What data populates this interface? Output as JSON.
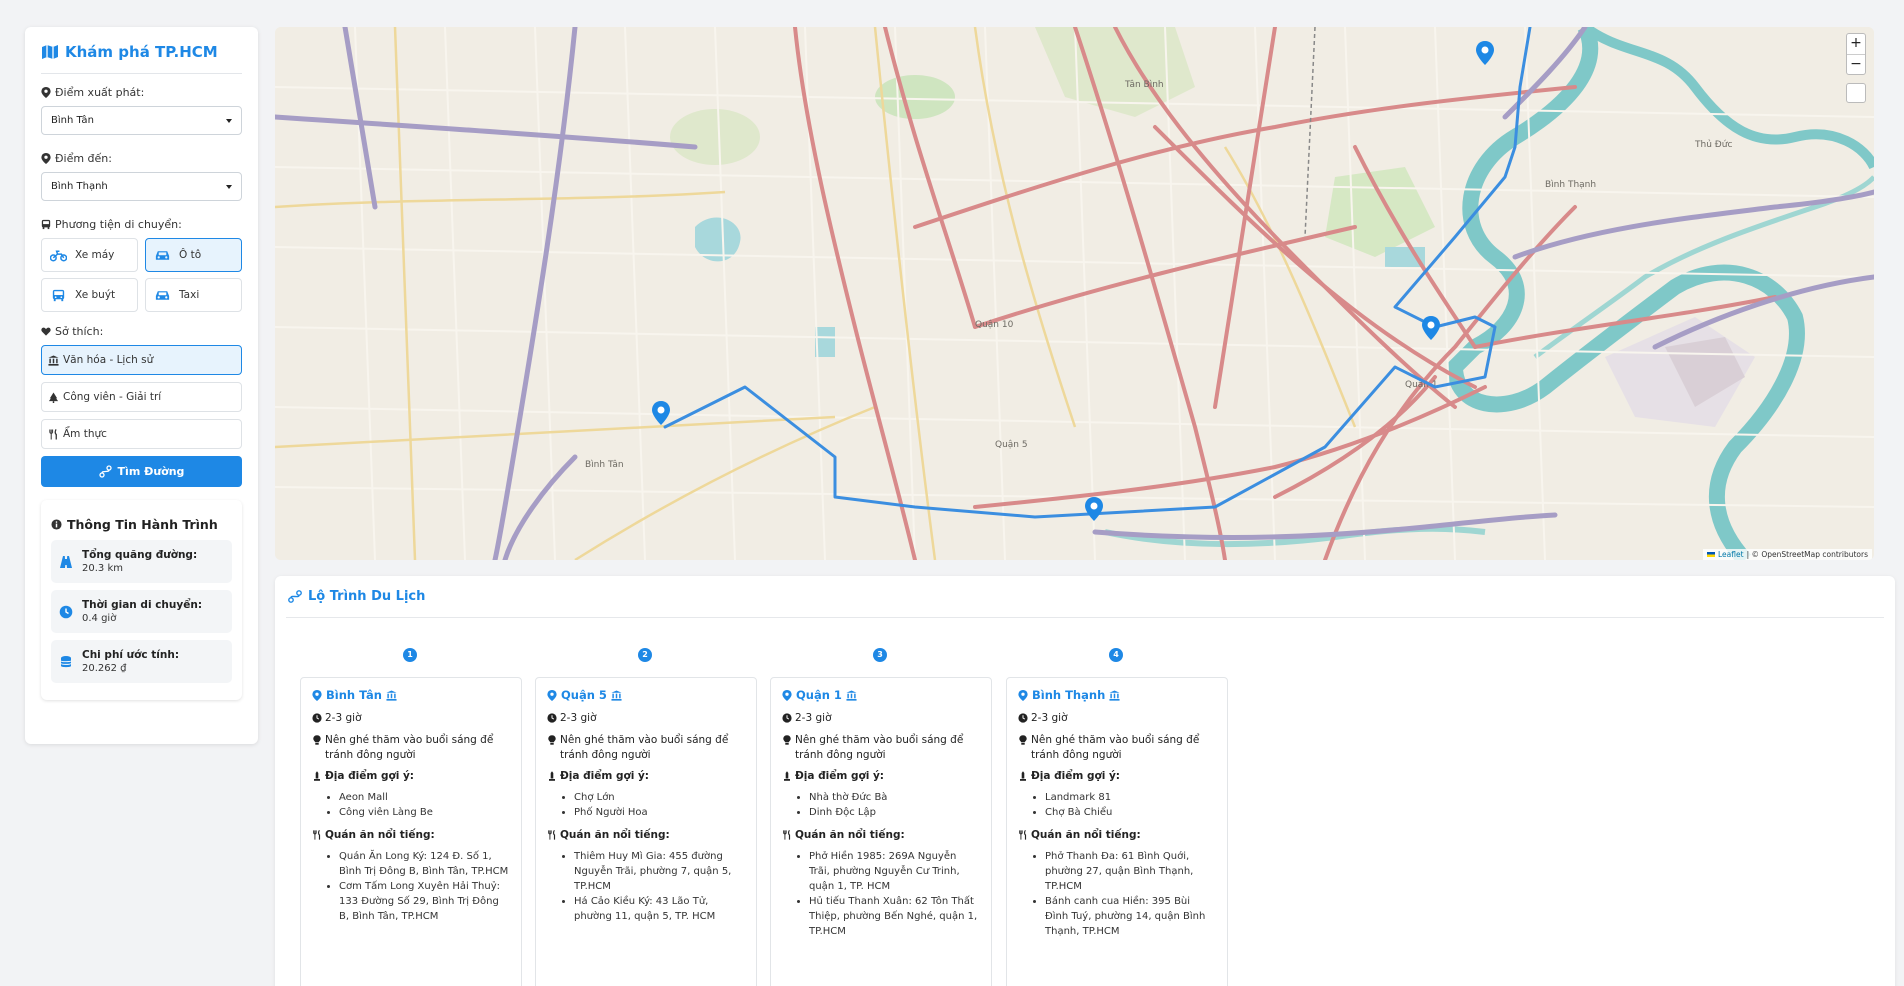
{
  "sidebar": {
    "brand": "Khám phá TP.HCM",
    "start_label": "Điểm xuất phát:",
    "start_value": "Bình Tân",
    "end_label": "Điểm đến:",
    "end_value": "Bình Thạnh",
    "transport_label": "Phương tiện di chuyển:",
    "transports": [
      {
        "label": "Xe máy",
        "active": false
      },
      {
        "label": "Ô tô",
        "active": true
      },
      {
        "label": "Xe buýt",
        "active": false
      },
      {
        "label": "Taxi",
        "active": false
      }
    ],
    "prefs_label": "Sở thích:",
    "prefs": [
      {
        "label": "Văn hóa - Lịch sử",
        "active": true
      },
      {
        "label": "Công viên - Giải trí",
        "active": false
      },
      {
        "label": "Ẩm thực",
        "active": false
      }
    ],
    "find_button": "Tìm Đường",
    "trip_info": {
      "title": "Thông Tin Hành Trình",
      "distance_label": "Tổng quãng đường:",
      "distance_value": "20.3 km",
      "time_label": "Thời gian di chuyển:",
      "time_value": "0.4 giờ",
      "cost_label": "Chi phí ước tính:",
      "cost_value": "20.262 ₫"
    }
  },
  "map": {
    "zoom_in": "+",
    "zoom_out": "−",
    "attribution_leaflet": "Leaflet",
    "attribution_rest": "| © OpenStreetMap contributors",
    "labels": {
      "binh_tan": "Bình Tân",
      "tan_binh": "Tân Bình",
      "quan_10": "Quận 10",
      "quan_1": "Quận 1",
      "binh_thanh": "Bình Thạnh",
      "quan_5": "Quận 5",
      "thu_duc": "Thủ Đức"
    },
    "colors": {
      "route": "#3b8ee0",
      "river": "#7fc8c8",
      "major_road": "#d88a8a",
      "marker": "#1e88e5"
    }
  },
  "itinerary": {
    "title": "Lộ Trình Du Lịch",
    "duration_label": "2-3 giờ",
    "tip_text": "Nên ghé thăm vào buổi sáng để tránh đông người",
    "places_label": "Địa điểm gợi ý:",
    "food_label": "Quán ăn nổi tiếng:",
    "stops": [
      {
        "num": "1",
        "name": "Bình Tân",
        "places": [
          "Aeon Mall",
          "Công viên Làng Be"
        ],
        "foods": [
          "Quán Ăn Long Ký: 124 Đ. Số 1, Bình Trị Đông B, Bình Tân, TP.HCM",
          "Cơm Tấm Long Xuyên Hải Thuỷ: 133 Đường Số 29, Bình Trị Đông B, Bình Tân, TP.HCM"
        ]
      },
      {
        "num": "2",
        "name": "Quận 5",
        "places": [
          "Chợ Lớn",
          "Phố Người Hoa"
        ],
        "foods": [
          "Thiêm Huy Mì Gia: 455 đường Nguyễn Trãi, phường 7, quận 5, TP.HCM",
          "Há Cảo Kiều Ký: 43 Lão Tử, phường 11, quận 5, TP. HCM"
        ]
      },
      {
        "num": "3",
        "name": "Quận 1",
        "places": [
          "Nhà thờ Đức Bà",
          "Dinh Độc Lập"
        ],
        "foods": [
          "Phở Hiền 1985: 269A Nguyễn Trãi, phường Nguyễn Cư Trinh, quận 1, TP. HCM",
          "Hủ tiếu Thanh Xuân: 62 Tôn Thất Thiệp, phường Bến Nghé, quận 1, TP.HCM"
        ]
      },
      {
        "num": "4",
        "name": "Bình Thạnh",
        "places": [
          "Landmark 81",
          "Chợ Bà Chiểu"
        ],
        "foods": [
          "Phở Thanh Đa: 61 Bình Quới, phường 27, quận Bình Thạnh, TP.HCM",
          "Bánh canh cua Hiền: 395 Bùi Đình Tuý, phường 14, quận Bình Thạnh, TP.HCM"
        ]
      }
    ]
  }
}
